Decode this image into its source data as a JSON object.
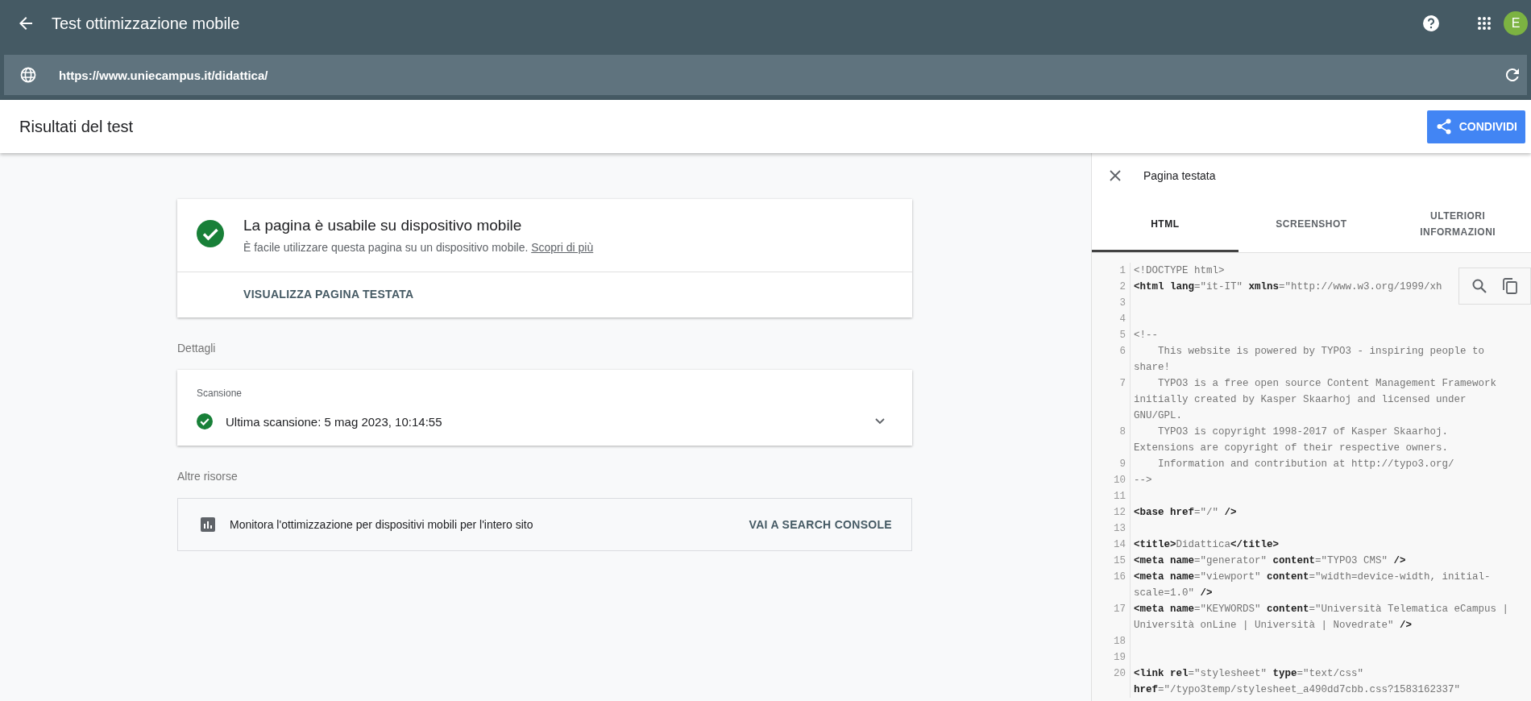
{
  "header": {
    "title": "Test ottimizzazione mobile",
    "avatar": "E"
  },
  "url_bar": {
    "value": "https://www.uniecampus.it/didattica/"
  },
  "results_bar": {
    "title": "Risultati del test",
    "share_button": "CONDIVIDI"
  },
  "result_card": {
    "title": "La pagina è usabile su dispositivo mobile",
    "description": "È facile utilizzare questa pagina su un dispositivo mobile.",
    "link": "Scopri di più",
    "action": "VISUALIZZA PAGINA TESTATA"
  },
  "details": {
    "heading": "Dettagli",
    "section": "Scansione",
    "crawl": "Ultima scansione: 5 mag 2023, 10:14:55",
    "expanded": false
  },
  "resources": {
    "heading": "Altre risorse",
    "text": "Monitora l'ottimizzazione per dispositivi mobili per l'intero sito",
    "action": "VAI A SEARCH CONSOLE"
  },
  "side_panel": {
    "title": "Pagina testata",
    "tabs": [
      {
        "label": "HTML",
        "selected": true
      },
      {
        "label": "SCREENSHOT",
        "selected": false
      },
      {
        "label": "ULTERIORI INFORMAZIONI",
        "selected": false
      }
    ],
    "code_lines": [
      {
        "number": "1",
        "segments": [
          {
            "kind": "text",
            "text": "<!DOCTYPE html>"
          }
        ]
      },
      {
        "number": "2",
        "segments": [
          {
            "kind": "markup",
            "text": "<html lang"
          },
          {
            "kind": "text",
            "text": "=\"it-IT\" "
          },
          {
            "kind": "markup",
            "text": "xmlns"
          },
          {
            "kind": "text",
            "text": "=\"http://www.w3.org/1999/xh"
          }
        ]
      },
      {
        "number": "3"
      },
      {
        "number": "4"
      },
      {
        "number": "5",
        "segments": [
          {
            "kind": "text",
            "text": "<!--"
          }
        ]
      },
      {
        "number": "6",
        "segments": [
          {
            "kind": "text",
            "text": "    This website is powered by TYPO3 - inspiring people to share!"
          }
        ]
      },
      {
        "number": "7",
        "segments": [
          {
            "kind": "text",
            "text": "    TYPO3 is a free open source Content Management Framework initially created by Kasper Skaarhoj and licensed under GNU/GPL."
          }
        ]
      },
      {
        "number": "8",
        "segments": [
          {
            "kind": "text",
            "text": "    TYPO3 is copyright 1998-2017 of Kasper Skaarhoj. Extensions are copyright of their respective owners."
          }
        ]
      },
      {
        "number": "9",
        "segments": [
          {
            "kind": "text",
            "text": "    Information and contribution at http://typo3.org/"
          }
        ]
      },
      {
        "number": "10",
        "segments": [
          {
            "kind": "text",
            "text": "-->"
          }
        ]
      },
      {
        "number": "11"
      },
      {
        "number": "12",
        "segments": [
          {
            "kind": "markup",
            "text": "<base href"
          },
          {
            "kind": "text",
            "text": "=\"/\" "
          },
          {
            "kind": "markup",
            "text": "/>"
          }
        ]
      },
      {
        "number": "13"
      },
      {
        "number": "14",
        "segments": [
          {
            "kind": "markup",
            "text": "<title>"
          },
          {
            "kind": "text",
            "text": "Didattica"
          },
          {
            "kind": "markup",
            "text": "</title>"
          }
        ]
      },
      {
        "number": "15",
        "segments": [
          {
            "kind": "markup",
            "text": "<meta name"
          },
          {
            "kind": "text",
            "text": "=\"generator\" "
          },
          {
            "kind": "markup",
            "text": "content"
          },
          {
            "kind": "text",
            "text": "=\"TYPO3 CMS\" "
          },
          {
            "kind": "markup",
            "text": "/>"
          }
        ]
      },
      {
        "number": "16",
        "segments": [
          {
            "kind": "markup",
            "text": "<meta name"
          },
          {
            "kind": "text",
            "text": "=\"viewport\" "
          },
          {
            "kind": "markup",
            "text": "content"
          },
          {
            "kind": "text",
            "text": "=\"width=device-width, initial-scale=1.0\" "
          },
          {
            "kind": "markup",
            "text": "/>"
          }
        ]
      },
      {
        "number": "17",
        "segments": [
          {
            "kind": "markup",
            "text": "<meta name"
          },
          {
            "kind": "text",
            "text": "=\"KEYWORDS\" "
          },
          {
            "kind": "markup",
            "text": "content"
          },
          {
            "kind": "text",
            "text": "=\"Università Telematica eCampus | Università onLine | Università | Novedrate\" "
          },
          {
            "kind": "markup",
            "text": "/>"
          }
        ]
      },
      {
        "number": "18"
      },
      {
        "number": "19"
      },
      {
        "number": "20",
        "segments": [
          {
            "kind": "markup",
            "text": "<link rel"
          },
          {
            "kind": "text",
            "text": "=\"stylesheet\" "
          },
          {
            "kind": "markup",
            "text": "type"
          },
          {
            "kind": "text",
            "text": "=\"text/css\" "
          },
          {
            "kind": "markup",
            "text": "href"
          },
          {
            "kind": "text",
            "text": "=\"/typo3temp/stylesheet_a490dd7cbb.css?1583162337\""
          }
        ]
      }
    ]
  }
}
